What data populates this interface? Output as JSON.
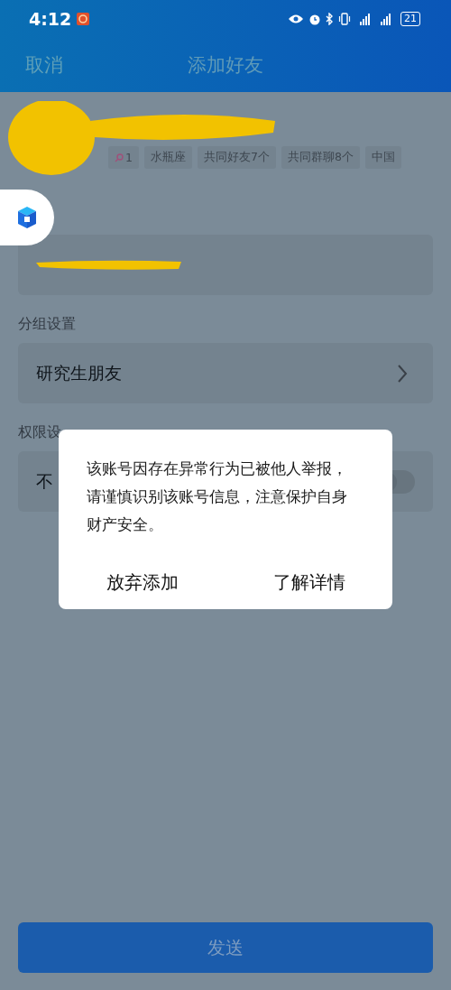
{
  "status_bar": {
    "time": "4:12",
    "battery": "21"
  },
  "nav": {
    "cancel": "取消",
    "title": "添加好友"
  },
  "profile": {
    "tags": [
      {
        "kind": "search",
        "label": "1"
      },
      {
        "kind": "text",
        "label": "水瓶座"
      },
      {
        "kind": "text",
        "label": "共同好友7个"
      },
      {
        "kind": "text",
        "label": "共同群聊8个"
      },
      {
        "kind": "text",
        "label": "中国"
      }
    ]
  },
  "group": {
    "label": "分组设置",
    "value": "研究生朋友"
  },
  "permission": {
    "label": "权限设",
    "row_text": "不",
    "toggle_on": false
  },
  "send_button": "发送",
  "dialog": {
    "message": "该账号因存在异常行为已被他人举报，请谨慎识别该账号信息，注意保护自身财产安全。",
    "buttons": [
      "放弃添加",
      "了解详情"
    ]
  }
}
